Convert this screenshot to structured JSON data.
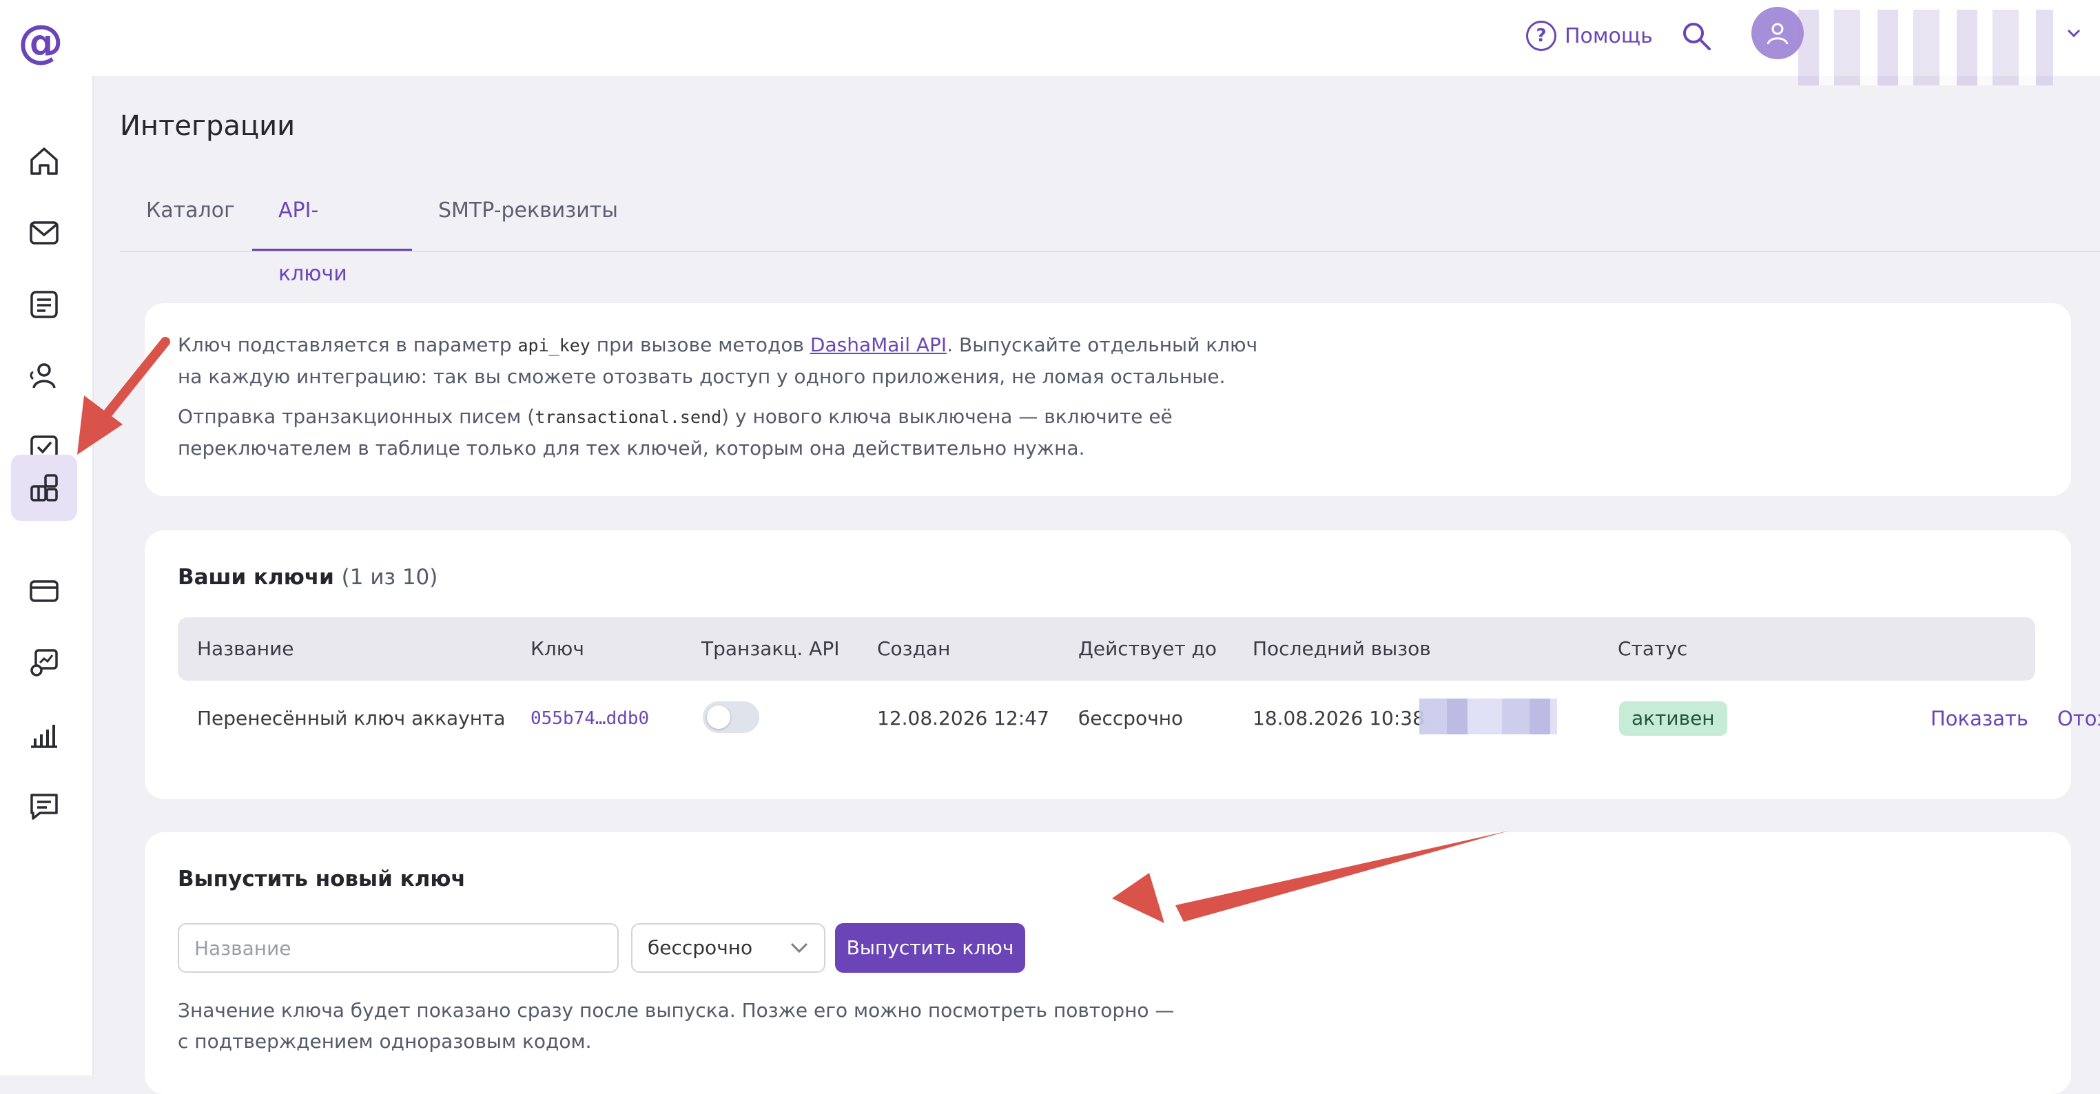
{
  "header": {
    "logo": "@",
    "help_label": "Помощь",
    "help_glyph": "?",
    "search_icon": "search-icon",
    "avatar_icon": "user-icon"
  },
  "sidebar": {
    "items": [
      {
        "icon": "home-icon"
      },
      {
        "icon": "mail-icon"
      },
      {
        "icon": "document-icon"
      },
      {
        "icon": "contacts-icon"
      },
      {
        "icon": "campaign-check-icon"
      },
      {
        "icon": "integrations-icon",
        "active": true
      },
      {
        "icon": "billing-card-icon"
      },
      {
        "icon": "settings-chart-icon"
      },
      {
        "icon": "stats-bars-icon"
      },
      {
        "icon": "chat-icon"
      }
    ]
  },
  "page": {
    "title": "Интеграции",
    "tabs": [
      "Каталог",
      "API-ключи",
      "SMTP-реквизиты"
    ],
    "active_tab": "API-ключи"
  },
  "info": {
    "p1_a": "Ключ подставляется в параметр ",
    "p1_code": "api_key",
    "p1_b": " при вызове методов ",
    "p1_link": "DashaMail API",
    "p1_c": ". Выпускайте отдельный ключ на каждую интеграцию: так вы сможете отозвать доступ у одного приложения, не ломая остальные.",
    "p2_a": "Отправка транзакционных писем (",
    "p2_code": "transactional.send",
    "p2_b": ") у нового ключа выключена — включите её переключателем в таблице только для тех ключей, которым она действительно нужна."
  },
  "keys": {
    "title": "Ваши ключи",
    "count": "(1 из 10)",
    "columns": [
      "Название",
      "Ключ",
      "Транзакц. API",
      "Создан",
      "Действует до",
      "Последний вызов",
      "Статус"
    ],
    "rows": [
      {
        "name": "Перенесённый ключ аккаунта",
        "key": "055b74…ddb0",
        "transactional_enabled": false,
        "created": "12.08.2026 12:47",
        "valid_until": "бессрочно",
        "last_call": "18.08.2026 10:38",
        "status": "активен",
        "actions": [
          "Показать",
          "Отозвать"
        ]
      }
    ]
  },
  "new_key": {
    "title": "Выпустить новый ключ",
    "name_placeholder": "Название",
    "validity_selected": "бессрочно",
    "submit_label": "Выпустить ключ",
    "hint": "Значение ключа будет показано сразу после выпуска. Позже его можно посмотреть повторно — с подтверждением одноразовым кодом."
  },
  "colors": {
    "accent": "#6b45b8",
    "annotation_arrow": "#d9534a",
    "status_active_bg": "#c6ecd7"
  }
}
